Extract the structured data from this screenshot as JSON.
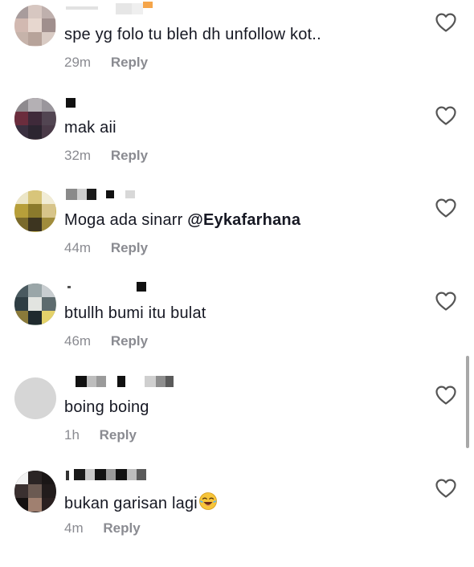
{
  "comments": [
    {
      "text": "spe yg folo tu bleh dh unfollow kot..",
      "time": "29m",
      "reply": "Reply",
      "mention": ""
    },
    {
      "text": "mak aii",
      "time": "32m",
      "reply": "Reply",
      "mention": ""
    },
    {
      "text": "Moga ada sinarr ",
      "time": "44m",
      "reply": "Reply",
      "mention": "@Eykafarhana"
    },
    {
      "text": "btullh bumi itu bulat",
      "time": "46m",
      "reply": "Reply",
      "mention": ""
    },
    {
      "text": "boing boing",
      "time": "1h",
      "reply": "Reply",
      "mention": ""
    },
    {
      "text": "bukan garisan lagi",
      "time": "4m",
      "reply": "Reply",
      "mention": ""
    }
  ],
  "icons": {
    "like": "heart-outline-icon",
    "laugh_emoji": "face-with-tears-of-joy-icon"
  },
  "colors": {
    "text": "#161823",
    "meta": "#8a8b91",
    "icon": "#555555"
  }
}
